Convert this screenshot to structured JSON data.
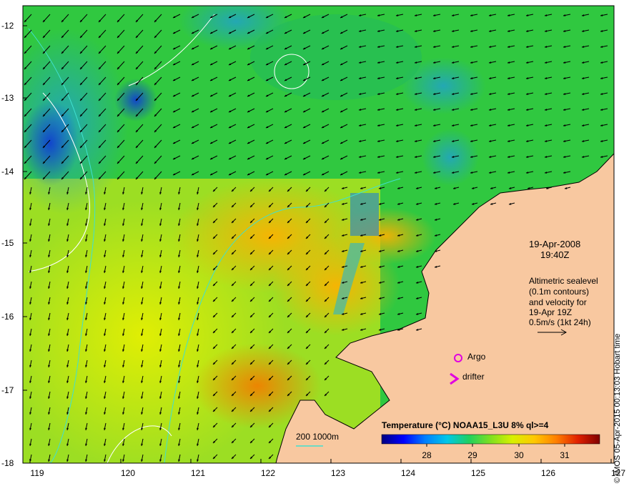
{
  "map": {
    "lon_ticks": [
      "119",
      "120",
      "121",
      "122",
      "123",
      "124",
      "125",
      "126",
      "127"
    ],
    "lat_ticks": [
      "-12",
      "-13",
      "-14",
      "-15",
      "-16",
      "-17",
      "-18"
    ],
    "lon_range": [
      118.6,
      127
    ],
    "lat_range": [
      -18,
      -11.7
    ]
  },
  "info": {
    "date": "19-Apr-2008",
    "time": "19:40Z",
    "altimetric_lines": [
      "Altimetric sealevel",
      "(0.1m contours)",
      "and velocity for",
      "19-Apr 19Z",
      "0.5m/s (1kt 24h)"
    ]
  },
  "legend": {
    "argo_label": "Argo",
    "drifter_label": "drifter",
    "bathymetry_label": "200  1000m",
    "colorbar_title": "Temperature (°C) NOAA15_L3U 8% ql>=4",
    "colorbar_ticks": [
      "28",
      "29",
      "30",
      "31"
    ]
  },
  "credit": "© IMOS 05-Apr-2015 00:13:03 Hobart time",
  "colors": {
    "land": "#f8c8a0",
    "argo": "#e000e0",
    "drifter": "#e000e0",
    "bathymetry": "#40e0d0",
    "colorbar": [
      "#000080",
      "#0000ff",
      "#0080ff",
      "#00c0ff",
      "#00e0a0",
      "#40d040",
      "#a0e020",
      "#e0f000",
      "#ffd000",
      "#ff9000",
      "#ff4000",
      "#c00000",
      "#800000"
    ]
  }
}
